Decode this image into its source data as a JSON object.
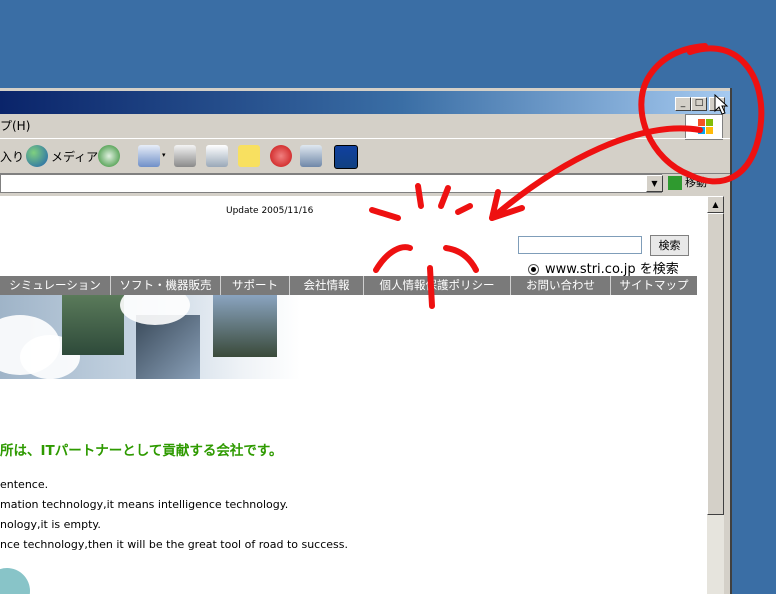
{
  "window": {
    "buttons": {
      "minimize": "_",
      "maximize": "□",
      "close": "×"
    }
  },
  "menubar": {
    "help_fragment": "プ(H)"
  },
  "toolbar": {
    "favorites_fragment": "入り",
    "media_label": "メディア",
    "icons": [
      "globe-icon",
      "history-icon",
      "mail-icon",
      "print-icon",
      "edit-icon",
      "note-icon",
      "messenger-icon",
      "research-icon",
      "app-icon"
    ]
  },
  "addressbar": {
    "go_label": "移動"
  },
  "page": {
    "update": "Update 2005/11/16",
    "search": {
      "button": "検索",
      "radio_label": "www.stri.co.jp を検索"
    },
    "nav": [
      "シミュレーション",
      "ソフト・機器販売",
      "サポート",
      "会社情報",
      "個人情報保護ポリシー",
      "お問い合わせ",
      "サイトマップ"
    ],
    "headline": "所は、ITパートナーとして貢献する会社です。",
    "body_lines": [
      "entence.",
      "mation technology,it means intelligence technology.",
      "nology,it is empty.",
      "nce technology,then it will be the great tool of road to success."
    ]
  },
  "annotation_colors": {
    "marker": "#ee1111"
  }
}
